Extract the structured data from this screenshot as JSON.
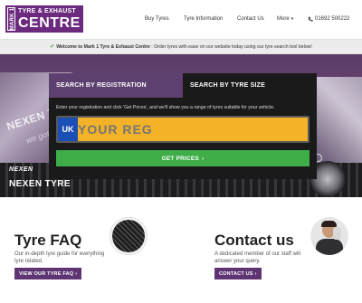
{
  "header": {
    "logo": {
      "side_text": "MARK 1",
      "top_text": "TYRE & EXHAUST",
      "main_text": "CENTRE"
    },
    "nav": {
      "buy_tyres": "Buy Tyres",
      "tyre_information": "Tyre Information",
      "contact_us": "Contact Us",
      "more": "More",
      "phone": "01692 500222"
    }
  },
  "welcome_bar": {
    "bold": "Welcome to Mark 1 Tyre & Exhaust Centre",
    "text": " : Order tyres with ease on our website today using our tyre search tool below!"
  },
  "hero": {
    "brand_logo": "NEXEN",
    "brand_name": "NEXEN TYRE",
    "background_text": "NEXEN TYR",
    "background_tagline": "we got you"
  },
  "search": {
    "tabs": [
      "SEARCH BY REGISTRATION",
      "SEARCH BY TYRE SIZE"
    ],
    "active_tab": 0,
    "instructions": "Enter your registration and click 'Get Prices', and we'll show you a range of tyres suitable for your vehicle.",
    "plate_country": "UK",
    "reg_placeholder": "YOUR REG",
    "reg_value": "",
    "get_prices_label": "GET PRICES",
    "colors": {
      "plate": "#f4b228",
      "uk_band": "#1a4fb5",
      "button": "#3fae49",
      "active_tab": "#5e4070"
    }
  },
  "faq": {
    "title": "Tyre FAQ",
    "description": "Our in-depth tyre guide for everything tyre related.",
    "button_label": "VIEW OUR TYRE FAQ"
  },
  "contact": {
    "title": "Contact us",
    "description": "A dedicated member of our staff will answer your query.",
    "button_label": "CONTACT US"
  },
  "icons": {
    "check": "check-icon",
    "phone": "phone-icon",
    "chevron_right": "chevron-right-icon",
    "caret_down": "caret-down-icon"
  },
  "brand_color": "#6b2a7e"
}
